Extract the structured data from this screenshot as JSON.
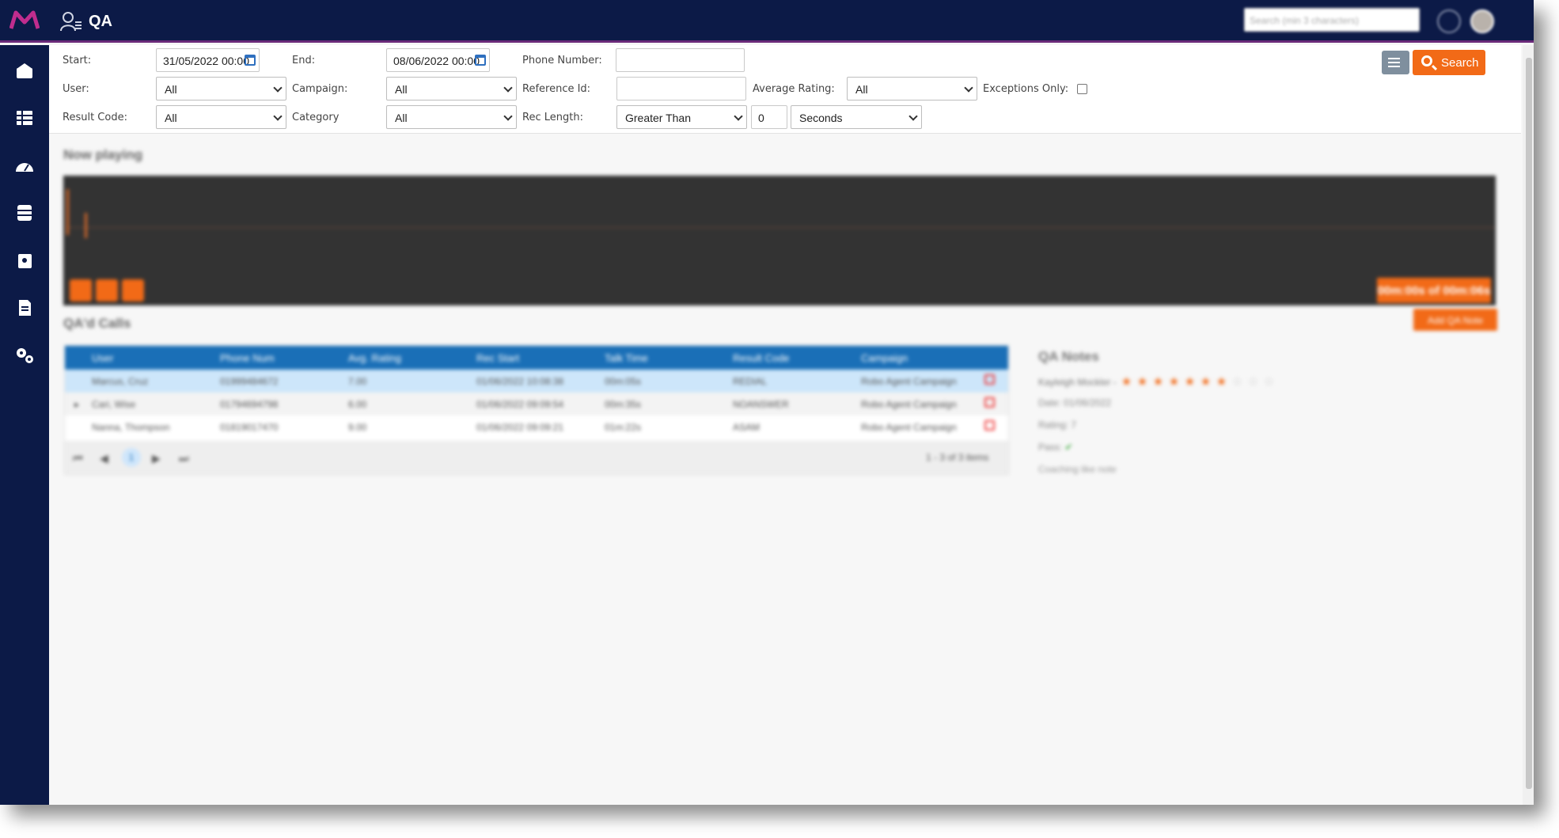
{
  "app": {
    "title": "QA",
    "search_placeholder": "Search (min 3 characters)"
  },
  "colors": {
    "topbar": "#0c1a47",
    "accent": "#f26a17",
    "grid_header": "#1a6fb7"
  },
  "filters": {
    "start_label": "Start:",
    "start_value": "31/05/2022 00:00",
    "end_label": "End:",
    "end_value": "08/06/2022 00:00",
    "phone_label": "Phone Number:",
    "phone_value": "",
    "user_label": "User:",
    "user_value": "All",
    "campaign_label": "Campaign:",
    "campaign_value": "All",
    "reference_label": "Reference Id:",
    "reference_value": "",
    "avg_rating_label": "Average Rating:",
    "avg_rating_value": "All",
    "exceptions_label": "Exceptions Only:",
    "result_code_label": "Result Code:",
    "result_code_value": "All",
    "category_label": "Category",
    "category_value": "All",
    "rec_length_label": "Rec Length:",
    "rec_length_op": "Greater Than",
    "rec_length_value": "0",
    "rec_length_unit": "Seconds",
    "search_button": "Search"
  },
  "now_playing": {
    "title": "Now playing",
    "time": "00m:00s of 00m:06s",
    "add_note": "Add QA Note"
  },
  "calls": {
    "title": "QA'd Calls",
    "columns": [
      "User",
      "Phone Num",
      "Avg. Rating",
      "Rec Start",
      "Talk Time",
      "Result Code",
      "Campaign"
    ],
    "rows": [
      {
        "user": "Marcus, Cruz",
        "phone": "01999484672",
        "rating": "7.00",
        "start": "01/06/2022 10:08:38",
        "talk": "00m:05s",
        "result": "REDIAL",
        "campaign": "Robo Agent Campaign"
      },
      {
        "user": "Cari, Wise",
        "phone": "01794694798",
        "rating": "6.00",
        "start": "01/06/2022 09:09:54",
        "talk": "00m:35s",
        "result": "NOANSWER",
        "campaign": "Robo Agent Campaign"
      },
      {
        "user": "Nanna, Thompson",
        "phone": "01819017470",
        "rating": "9.00",
        "start": "01/06/2022 09:09:21",
        "talk": "01m:22s",
        "result": "ASAM",
        "campaign": "Robo Agent Campaign"
      }
    ],
    "page": "1",
    "page_info": "1 - 3 of 3 items"
  },
  "qa_notes": {
    "title": "QA Notes",
    "author": "Kayleigh Mockler -",
    "stars_filled": 7,
    "stars_total": 10,
    "date": "Date: 01/06/2022",
    "rating": "Rating: 7",
    "pass": "Pass:",
    "note": "Coaching like note"
  }
}
